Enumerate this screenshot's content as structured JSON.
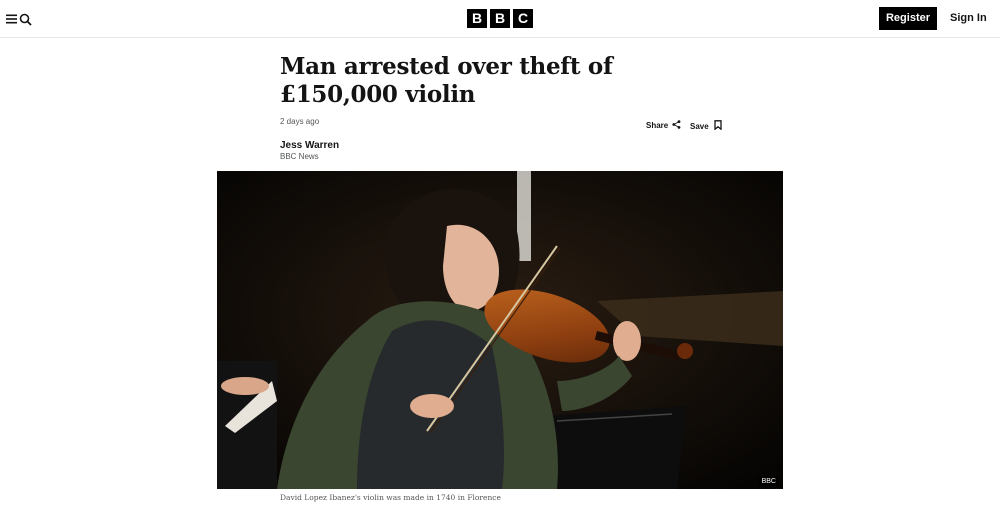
{
  "header": {
    "menu_icon": "hamburger-menu-icon",
    "search_icon": "search-icon",
    "logo_letters": [
      "B",
      "B",
      "C"
    ],
    "register_label": "Register",
    "signin_label": "Sign In"
  },
  "article": {
    "headline": "Man arrested over theft of £150,000 violin",
    "timestamp": "2 days ago",
    "share_label": "Share",
    "share_icon": "share-icon",
    "save_label": "Save",
    "save_icon": "bookmark-icon",
    "author_name": "Jess Warren",
    "author_org": "BBC News",
    "image": {
      "credit": "BBC",
      "caption": "David Lopez Ibanez's violin was made in 1740 in Florence"
    }
  },
  "colors": {
    "text": "#141414",
    "muted": "#545658",
    "button_bg": "#000000",
    "button_text": "#ffffff"
  }
}
